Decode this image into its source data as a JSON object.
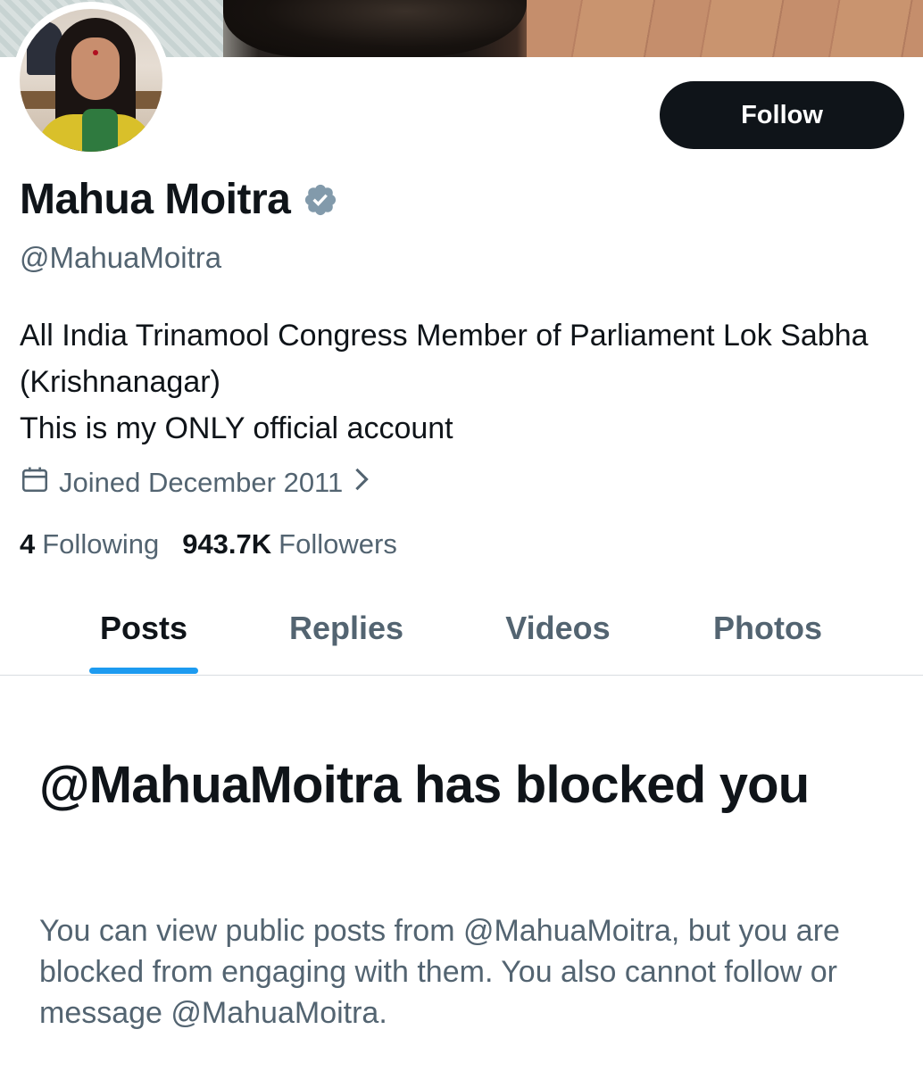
{
  "profile": {
    "name": "Mahua Moitra",
    "handle": "@MahuaMoitra",
    "bio_lines": [
      "All India Trinamool Congress Member of Parliament Lok Sabha (Krishnanagar)",
      "This is my ONLY official account"
    ],
    "joined": "Joined December 2011",
    "following_count": "4",
    "following_label": "Following",
    "followers_count": "943.7K",
    "followers_label": "Followers",
    "verified_color": "#829aab",
    "icons": {
      "verified": "verified-badge-icon",
      "joined": "calendar-icon",
      "joined_more": "chevron-right-icon"
    }
  },
  "actions": {
    "follow_label": "Follow"
  },
  "tabs": [
    {
      "label": "Posts",
      "active": true
    },
    {
      "label": "Replies",
      "active": false
    },
    {
      "label": "Videos",
      "active": false
    },
    {
      "label": "Photos",
      "active": false
    }
  ],
  "blocked": {
    "title": "@MahuaMoitra has blocked you",
    "description": "You can view public posts from @MahuaMoitra, but you are blocked from engaging with them. You also cannot follow or message @MahuaMoitra."
  },
  "colors": {
    "text_primary": "#0f1419",
    "text_secondary": "#536471",
    "accent": "#1d9bf0",
    "button_bg": "#0f1419"
  }
}
